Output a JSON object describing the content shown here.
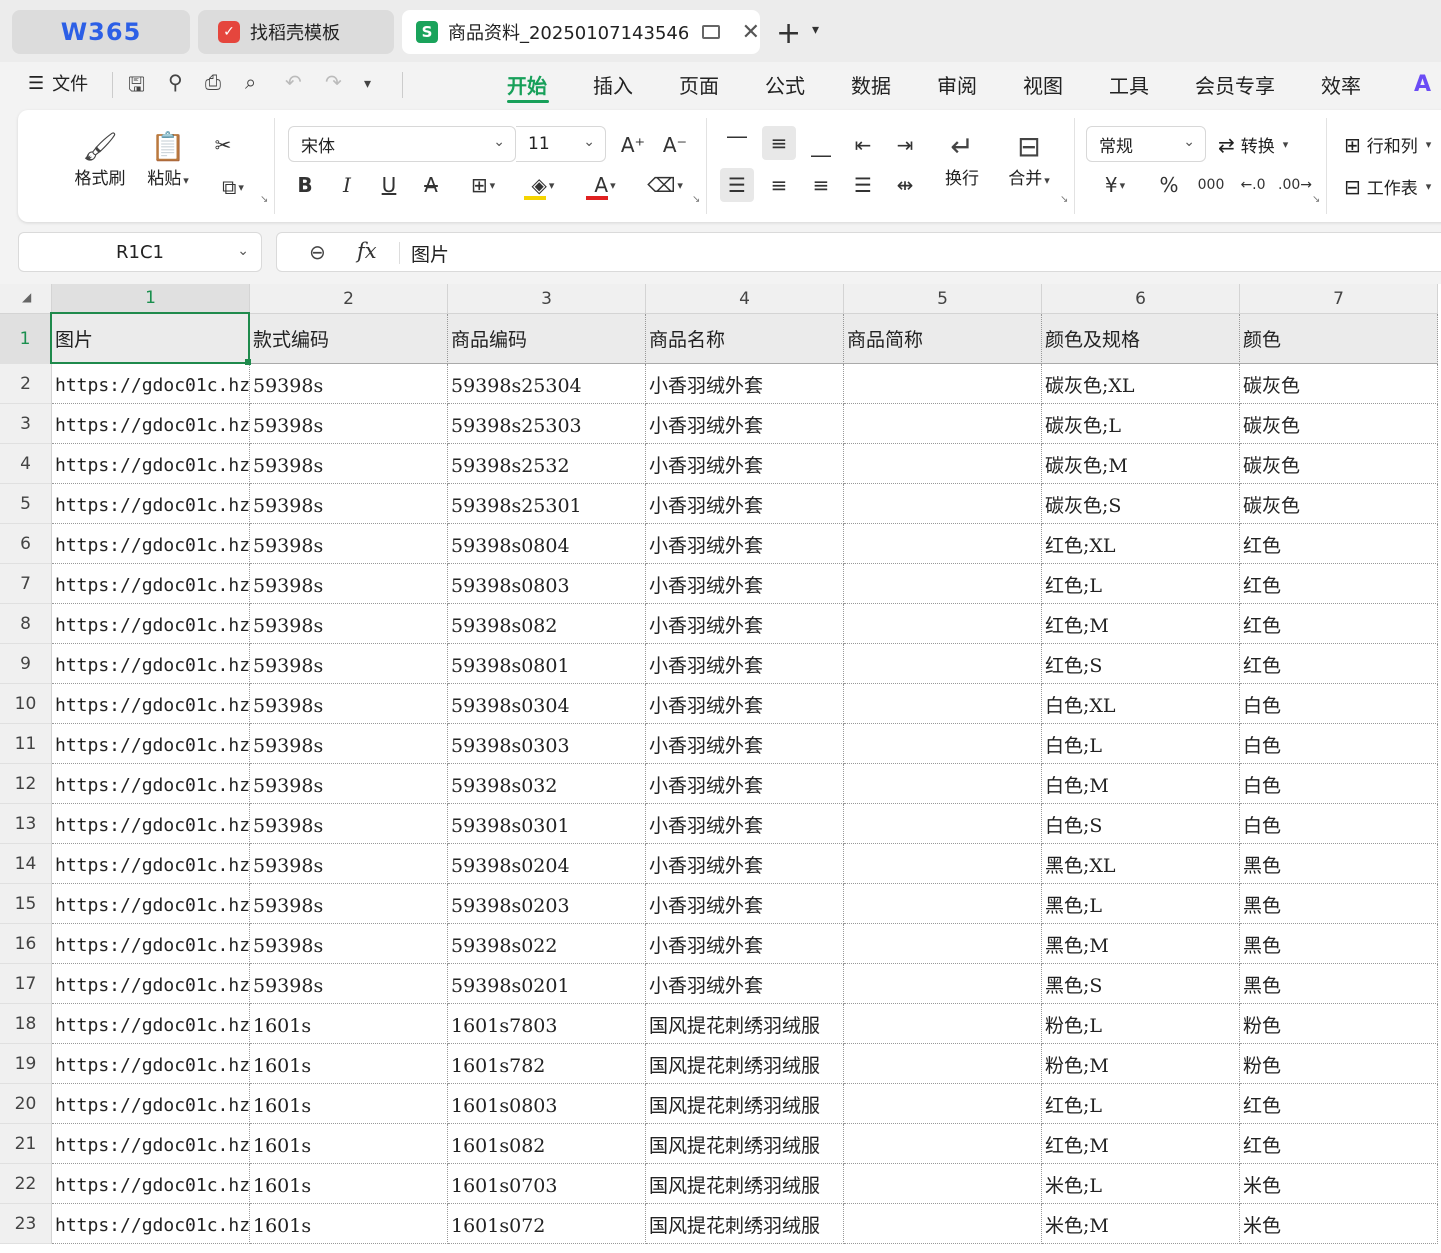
{
  "tabs": {
    "home_logo": "W365",
    "template_tab": "找稻壳模板",
    "file_tab": "商品资料_20250107143546_"
  },
  "menu": {
    "file_label": "文件",
    "tabs": [
      "开始",
      "插入",
      "页面",
      "公式",
      "数据",
      "审阅",
      "视图",
      "工具",
      "会员专享",
      "效率"
    ],
    "active_tab": "开始"
  },
  "ribbon": {
    "format_painter": "格式刷",
    "paste": "粘贴",
    "font_name": "宋体",
    "font_size": "11",
    "wrap_text": "换行",
    "merge": "合并",
    "number_format": "常规",
    "convert": "转换",
    "rows_cols": "行和列",
    "worksheet": "工作表",
    "font_color": "#e02020",
    "fill_color": "#f5d400"
  },
  "formula_bar": {
    "name_box": "R1C1",
    "fx": "fx",
    "value": "图片"
  },
  "grid": {
    "columns": [
      "1",
      "2",
      "3",
      "4",
      "5",
      "6",
      "7"
    ],
    "headers": [
      "图片",
      "款式编码",
      "商品编码",
      "商品名称",
      "商品简称",
      "颜色及规格",
      "颜色"
    ],
    "rows": [
      [
        "https://gdoc01c.hz",
        "59398s",
        "59398s25304",
        "小香羽绒外套",
        "",
        "碳灰色;XL",
        "碳灰色"
      ],
      [
        "https://gdoc01c.hz",
        "59398s",
        "59398s25303",
        "小香羽绒外套",
        "",
        "碳灰色;L",
        "碳灰色"
      ],
      [
        "https://gdoc01c.hz",
        "59398s",
        "59398s2532",
        "小香羽绒外套",
        "",
        "碳灰色;M",
        "碳灰色"
      ],
      [
        "https://gdoc01c.hz",
        "59398s",
        "59398s25301",
        "小香羽绒外套",
        "",
        "碳灰色;S",
        "碳灰色"
      ],
      [
        "https://gdoc01c.hz",
        "59398s",
        "59398s0804",
        "小香羽绒外套",
        "",
        "红色;XL",
        "红色"
      ],
      [
        "https://gdoc01c.hz",
        "59398s",
        "59398s0803",
        "小香羽绒外套",
        "",
        "红色;L",
        "红色"
      ],
      [
        "https://gdoc01c.hz",
        "59398s",
        "59398s082",
        "小香羽绒外套",
        "",
        "红色;M",
        "红色"
      ],
      [
        "https://gdoc01c.hz",
        "59398s",
        "59398s0801",
        "小香羽绒外套",
        "",
        "红色;S",
        "红色"
      ],
      [
        "https://gdoc01c.hz",
        "59398s",
        "59398s0304",
        "小香羽绒外套",
        "",
        "白色;XL",
        "白色"
      ],
      [
        "https://gdoc01c.hz",
        "59398s",
        "59398s0303",
        "小香羽绒外套",
        "",
        "白色;L",
        "白色"
      ],
      [
        "https://gdoc01c.hz",
        "59398s",
        "59398s032",
        "小香羽绒外套",
        "",
        "白色;M",
        "白色"
      ],
      [
        "https://gdoc01c.hz",
        "59398s",
        "59398s0301",
        "小香羽绒外套",
        "",
        "白色;S",
        "白色"
      ],
      [
        "https://gdoc01c.hz",
        "59398s",
        "59398s0204",
        "小香羽绒外套",
        "",
        "黑色;XL",
        "黑色"
      ],
      [
        "https://gdoc01c.hz",
        "59398s",
        "59398s0203",
        "小香羽绒外套",
        "",
        "黑色;L",
        "黑色"
      ],
      [
        "https://gdoc01c.hz",
        "59398s",
        "59398s022",
        "小香羽绒外套",
        "",
        "黑色;M",
        "黑色"
      ],
      [
        "https://gdoc01c.hz",
        "59398s",
        "59398s0201",
        "小香羽绒外套",
        "",
        "黑色;S",
        "黑色"
      ],
      [
        "https://gdoc01c.hz",
        "1601s",
        "1601s7803",
        "国风提花刺绣羽绒服",
        "",
        "粉色;L",
        "粉色"
      ],
      [
        "https://gdoc01c.hz",
        "1601s",
        "1601s782",
        "国风提花刺绣羽绒服",
        "",
        "粉色;M",
        "粉色"
      ],
      [
        "https://gdoc01c.hz",
        "1601s",
        "1601s0803",
        "国风提花刺绣羽绒服",
        "",
        "红色;L",
        "红色"
      ],
      [
        "https://gdoc01c.hz",
        "1601s",
        "1601s082",
        "国风提花刺绣羽绒服",
        "",
        "红色;M",
        "红色"
      ],
      [
        "https://gdoc01c.hz",
        "1601s",
        "1601s0703",
        "国风提花刺绣羽绒服",
        "",
        "米色;L",
        "米色"
      ],
      [
        "https://gdoc01c.hz",
        "1601s",
        "1601s072",
        "国风提花刺绣羽绒服",
        "",
        "米色;M",
        "米色"
      ]
    ]
  }
}
